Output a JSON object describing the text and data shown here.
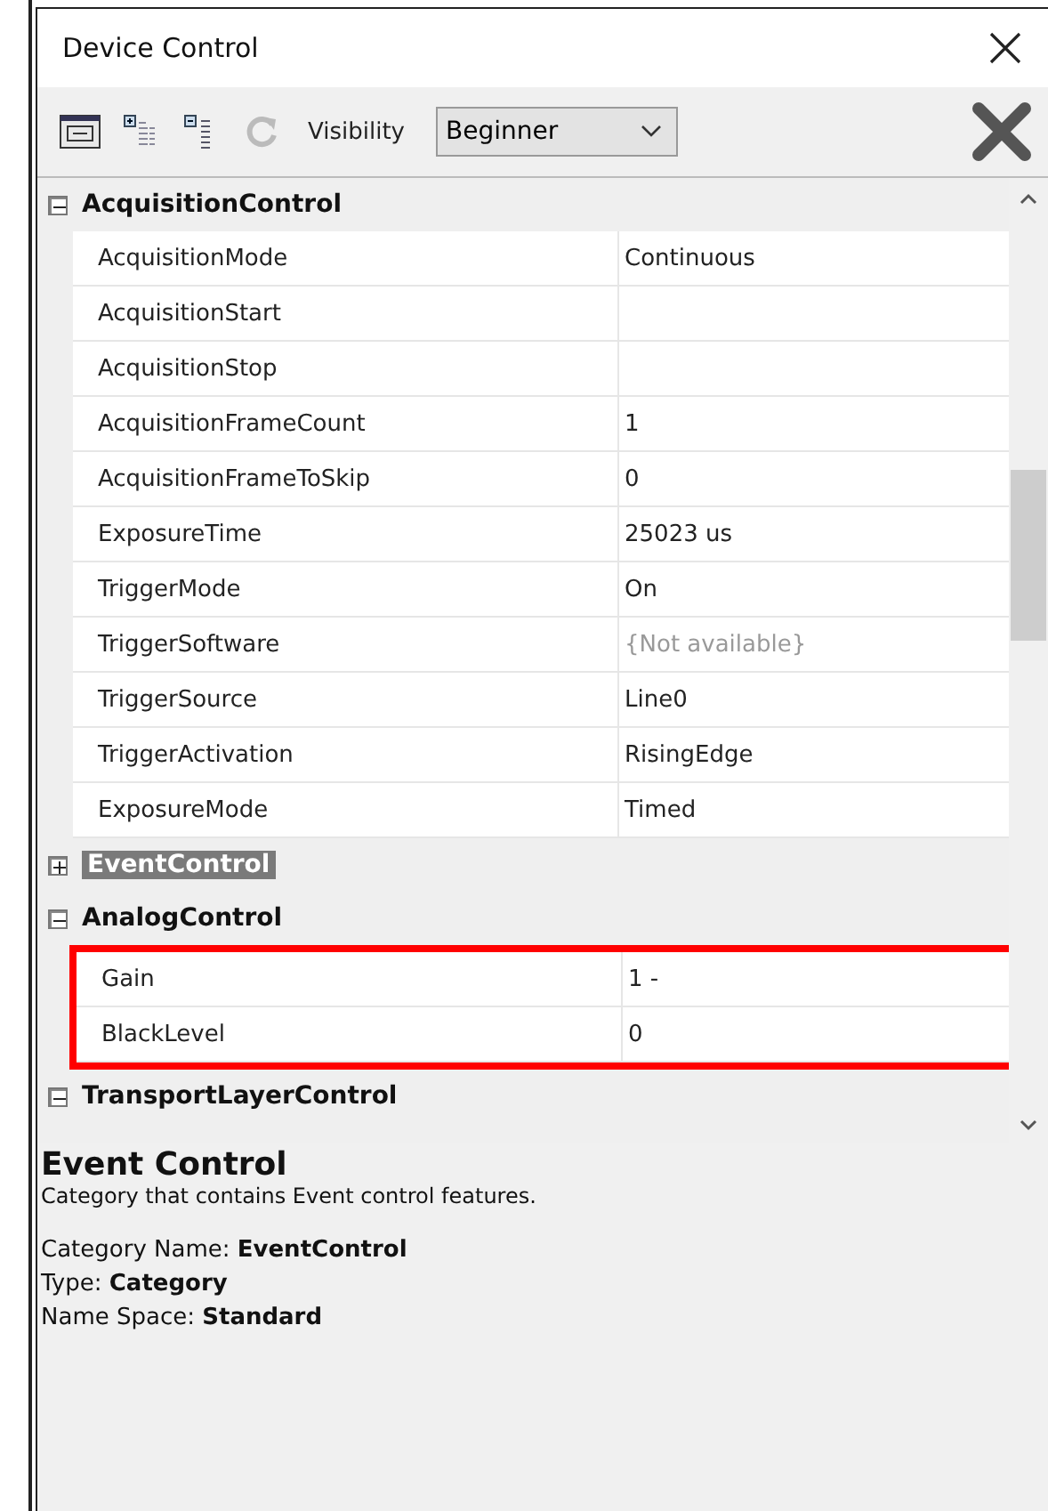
{
  "window": {
    "title": "Device Control"
  },
  "toolbar": {
    "visibility_label": "Visibility",
    "visibility": "Beginner"
  },
  "categories": [
    {
      "name": "AcquisitionControl",
      "expanded": true,
      "selected": false,
      "properties": [
        {
          "name": "AcquisitionMode",
          "value": "Continuous",
          "disabled": false,
          "highlighted": false
        },
        {
          "name": "AcquisitionStart",
          "highlighted": false
        },
        {
          "name": "AcquisitionStop",
          "highlighted": false
        },
        {
          "name": "AcquisitionFrameCount",
          "value": "1",
          "disabled": false,
          "highlighted": false
        },
        {
          "name": "AcquisitionFrameToSkip",
          "value": "0",
          "disabled": false,
          "highlighted": false
        },
        {
          "name": "ExposureTime",
          "value": "25023 us",
          "disabled": false,
          "highlighted": false
        },
        {
          "name": "TriggerMode",
          "value": "On",
          "disabled": false,
          "highlighted": false
        },
        {
          "name": "TriggerSoftware",
          "value": "{Not available}",
          "disabled": true,
          "highlighted": false
        },
        {
          "name": "TriggerSource",
          "value": "Line0",
          "disabled": false,
          "highlighted": false
        },
        {
          "name": "TriggerActivation",
          "value": "RisingEdge",
          "disabled": false,
          "highlighted": false
        },
        {
          "name": "ExposureMode",
          "value": "Timed",
          "disabled": false,
          "highlighted": false
        }
      ]
    },
    {
      "name": "EventControl",
      "expanded": false,
      "selected": true
    },
    {
      "name": "AnalogControl",
      "expanded": true,
      "selected": false,
      "properties": [
        {
          "name": "Gain",
          "value": "1 -",
          "disabled": false,
          "highlighted": true
        },
        {
          "name": "BlackLevel",
          "value": "0",
          "disabled": false,
          "highlighted": true
        }
      ]
    },
    {
      "name": "TransportLayerControl",
      "expanded": true,
      "selected": false
    }
  ],
  "info": {
    "title": "Event Control",
    "description": "Category that contains Event control features.",
    "fields": [
      {
        "label": "Category Name:",
        "value": "EventControl"
      },
      {
        "label": "Type:",
        "value": "Category"
      },
      {
        "label": "Name Space:",
        "value": "Standard"
      }
    ]
  }
}
